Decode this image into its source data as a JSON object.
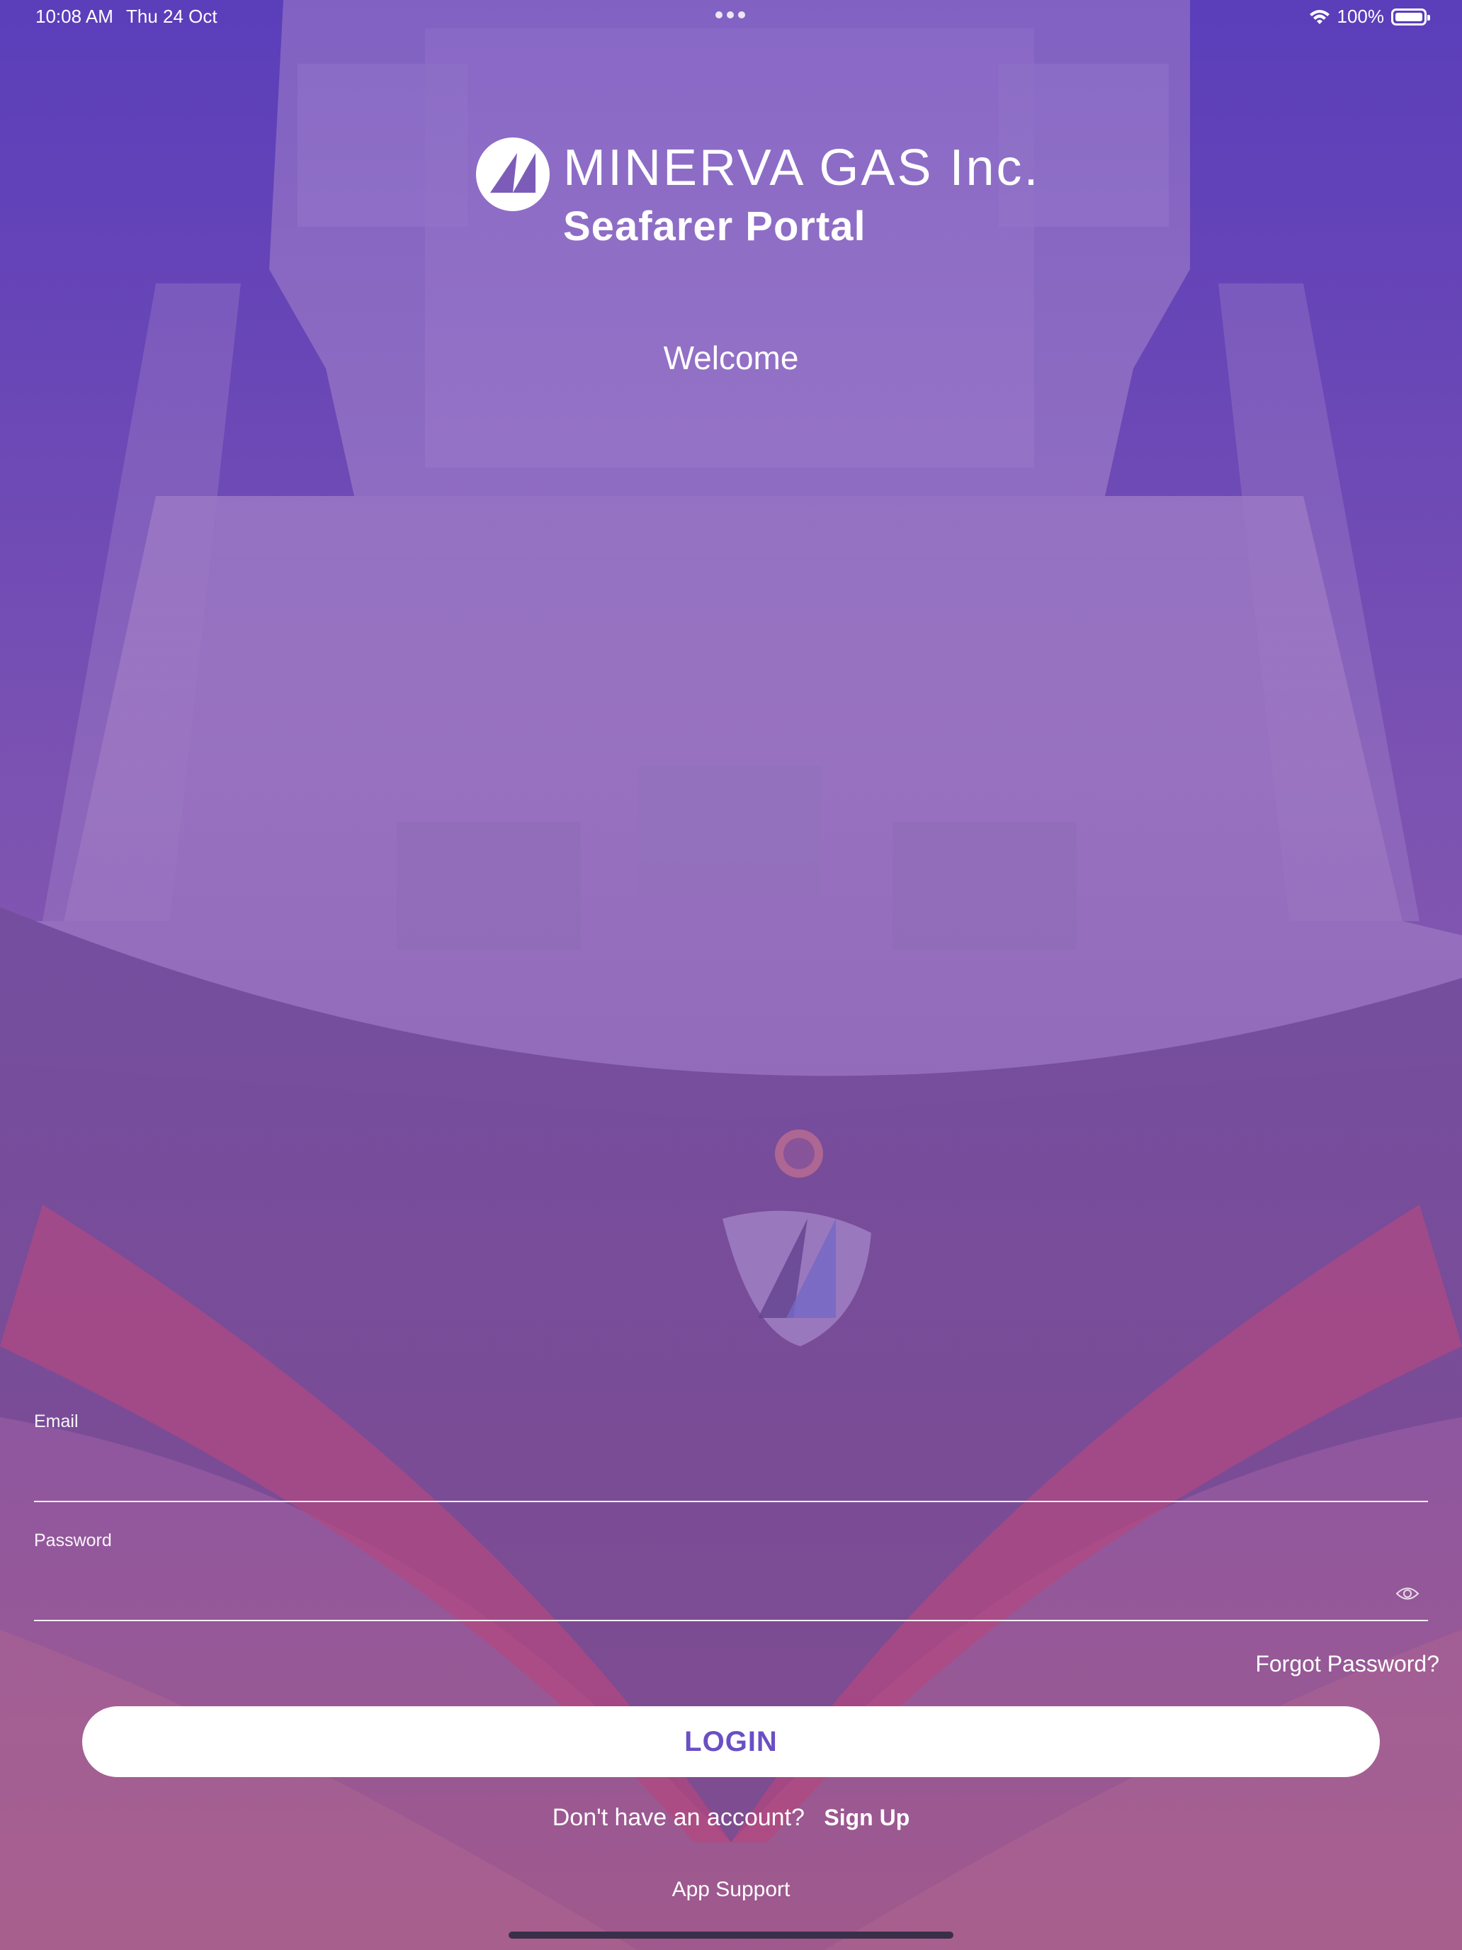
{
  "status_bar": {
    "time": "10:08 AM",
    "date": "Thu 24 Oct",
    "battery": "100%",
    "wifi_icon": "wifi-icon",
    "battery_icon": "battery-icon"
  },
  "header": {
    "brand": "MINERVA GAS Inc.",
    "portal": "Seafarer Portal",
    "logo_icon": "sail-logo-icon"
  },
  "welcome": "Welcome",
  "form": {
    "email_label": "Email",
    "email_value": "",
    "password_label": "Password",
    "password_value": "",
    "show_password_icon": "eye-icon",
    "forgot_password": "Forgot Password?",
    "login_label": "LOGIN"
  },
  "footer": {
    "no_account": "Don't have an account?",
    "sign_up": "Sign Up",
    "app_support": "App Support"
  },
  "colors": {
    "accent": "#6a4fc4",
    "background_top": "#6a48b8",
    "background_bottom": "#a45a86",
    "text": "#ffffff"
  }
}
